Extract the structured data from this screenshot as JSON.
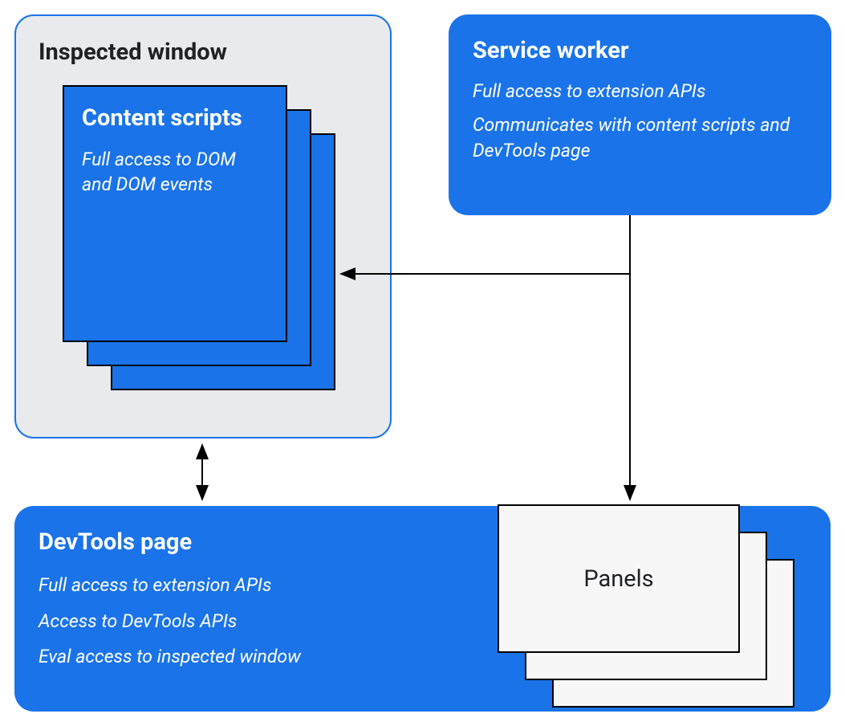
{
  "inspected": {
    "title": "Inspected window",
    "content_scripts": {
      "title": "Content scripts",
      "desc": "Full access to DOM and DOM events"
    }
  },
  "service_worker": {
    "title": "Service worker",
    "desc1": "Full access to extension APIs",
    "desc2": "Communicates with content scripts and DevTools page"
  },
  "devtools": {
    "title": "DevTools page",
    "desc1": "Full access to extension APIs",
    "desc2": "Access to DevTools APIs",
    "desc3": "Eval access to inspected window"
  },
  "panels": {
    "label": "Panels"
  }
}
